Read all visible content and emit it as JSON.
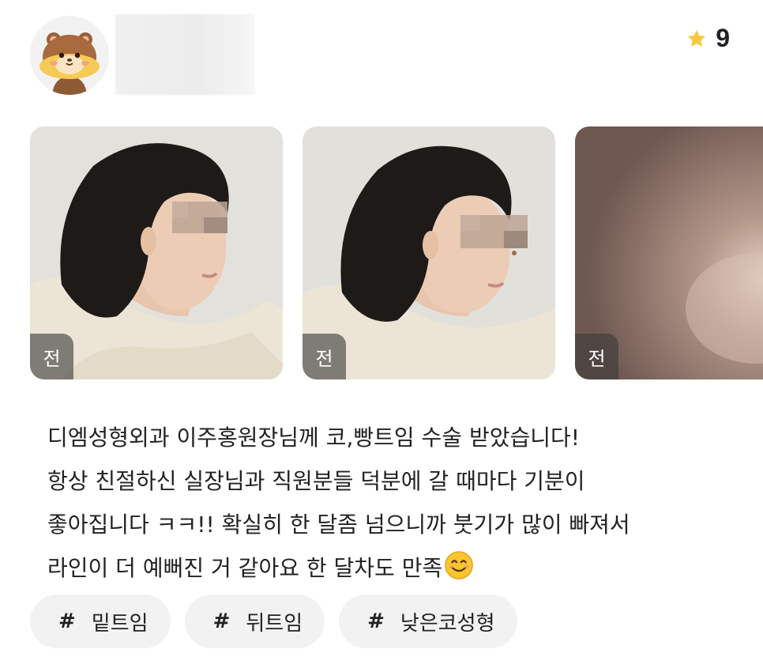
{
  "profile": {
    "avatar_icon": "hamster-avatar-icon"
  },
  "rating": {
    "icon": "star-icon",
    "value": "9",
    "star_color": "#f7c842"
  },
  "photos": [
    {
      "tag": "전"
    },
    {
      "tag": "전"
    },
    {
      "tag": "전"
    }
  ],
  "review": {
    "lines": [
      "디엠성형외과 이주홍원장님께 코,빵트임 수술 받았습니다!",
      "항상 친절하신 실장님과 직원분들 덕분에 갈 때마다 기분이",
      "좋아집니다 ㅋㅋ!! 확실히 한 달좀 넘으니까 붓기가 많이 빠져서",
      "라인이 더 예뻐진 거 같아요 한 달차도 만족"
    ],
    "emoji": "smiling-face-emoji"
  },
  "tags": [
    {
      "hash": "#",
      "label": "밑트임"
    },
    {
      "hash": "#",
      "label": "뒤트임"
    },
    {
      "hash": "#",
      "label": "낮은코성형"
    }
  ]
}
